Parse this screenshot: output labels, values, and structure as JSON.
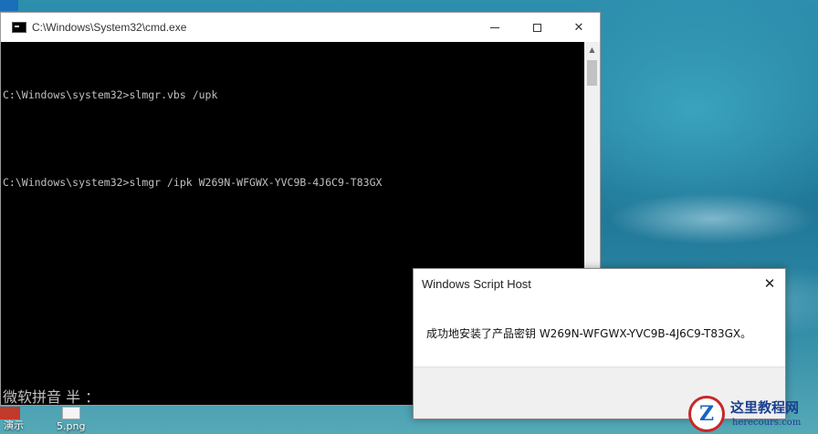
{
  "cmd_window": {
    "title": "C:\\Windows\\System32\\cmd.exe",
    "lines": [
      "C:\\Windows\\system32>slmgr.vbs /upk",
      "C:\\Windows\\system32>slmgr /ipk W269N-WFGWX-YVC9B-4J6C9-T83GX"
    ],
    "ime_status": "微软拼音 半 ："
  },
  "dialog": {
    "title": "Windows Script Host",
    "message": "成功地安装了产品密钥 W269N-WFGWX-YVC9B-4J6C9-T83GX。"
  },
  "desktop": {
    "icon_labels": [
      "演示",
      "5.png"
    ]
  },
  "watermark": {
    "title": "这里教程网",
    "site": "herecours.com"
  }
}
